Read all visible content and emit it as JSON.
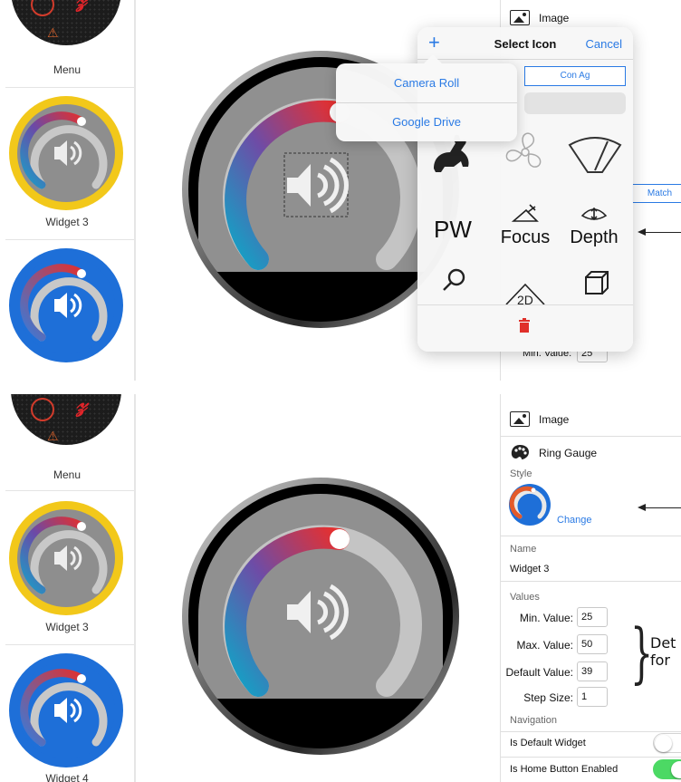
{
  "sidebar": {
    "captions": {
      "menu": "Menu",
      "widget3": "Widget 3",
      "widget4": "Widget 4"
    }
  },
  "properties": {
    "image_label": "Image",
    "ring_gauge_label": "Ring Gauge",
    "style_label": "Style",
    "change_label": "Change",
    "name_label": "Name",
    "name_value": "Widget 3",
    "values_label": "Values",
    "min_label": "Min. Value:",
    "min_value": "25",
    "max_label": "Max. Value:",
    "max_value": "50",
    "default_label": "Default Value:",
    "default_value": "39",
    "step_label": "Step Size:",
    "step_value": "1",
    "navigation_label": "Navigation",
    "is_default_label": "Is Default Widget",
    "is_default_on": false,
    "home_button_label": "Is Home Button Enabled",
    "home_button_on": true
  },
  "select_icon": {
    "title": "Select Icon",
    "cancel": "Cancel",
    "add": "+",
    "segment_active": "Con Ag",
    "icons": [
      {
        "name": "rabbit-icon",
        "label": ""
      },
      {
        "name": "fan-icon",
        "label": ""
      },
      {
        "name": "wiper-icon",
        "label": ""
      },
      {
        "name": "pw-icon",
        "label": "PW"
      },
      {
        "name": "focus-icon",
        "label": "Focus"
      },
      {
        "name": "depth-icon",
        "label": "Depth"
      },
      {
        "name": "magnifier-icon",
        "label": ""
      },
      {
        "name": "2d-icon",
        "label": "2D"
      },
      {
        "name": "cube-icon",
        "label": ""
      }
    ]
  },
  "source_menu": {
    "items": [
      "Camera Roll",
      "Google Drive"
    ]
  },
  "match_tab": "Match",
  "annotation": {
    "line1": "Det",
    "line2": "for"
  },
  "colors": {
    "accent": "#2a7ae4",
    "widget3_ring": "#f2c81a",
    "widget4_ring": "#1e6fd8",
    "toggle_on": "#4cd964"
  }
}
